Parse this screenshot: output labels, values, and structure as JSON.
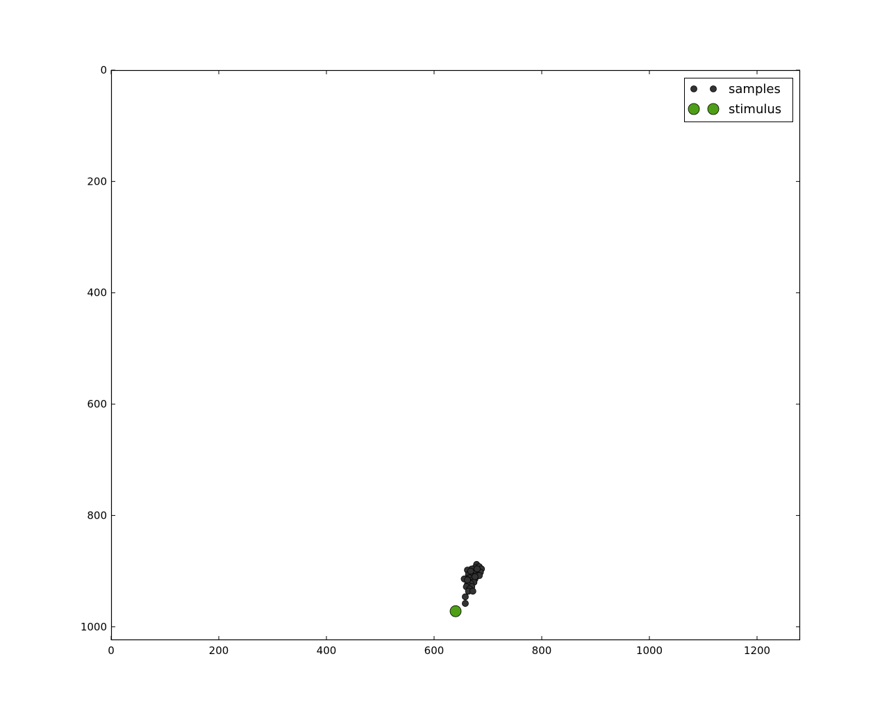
{
  "chart_data": {
    "type": "scatter",
    "title": "",
    "xlabel": "",
    "ylabel": "",
    "xlim": [
      0,
      1280
    ],
    "ylim": [
      1024,
      0
    ],
    "y_inverted": true,
    "grid": false,
    "legend_position": "top-right",
    "x_ticks": [
      0,
      200,
      400,
      600,
      800,
      1000,
      1200
    ],
    "y_ticks": [
      0,
      200,
      400,
      600,
      800,
      1000
    ],
    "series": [
      {
        "name": "samples",
        "color": "#333333",
        "marker": "small-circle",
        "points": [
          [
            679,
            888
          ],
          [
            684,
            892
          ],
          [
            688,
            896
          ],
          [
            676,
            894
          ],
          [
            670,
            896
          ],
          [
            662,
            898
          ],
          [
            682,
            900
          ],
          [
            686,
            902
          ],
          [
            678,
            904
          ],
          [
            674,
            902
          ],
          [
            668,
            904
          ],
          [
            664,
            906
          ],
          [
            680,
            908
          ],
          [
            684,
            908
          ],
          [
            672,
            910
          ],
          [
            666,
            912
          ],
          [
            660,
            914
          ],
          [
            656,
            914
          ],
          [
            676,
            914
          ],
          [
            670,
            916
          ],
          [
            664,
            918
          ],
          [
            674,
            920
          ],
          [
            668,
            922
          ],
          [
            662,
            924
          ],
          [
            660,
            928
          ],
          [
            670,
            928
          ],
          [
            666,
            932
          ],
          [
            664,
            936
          ],
          [
            672,
            936
          ],
          [
            658,
            946
          ],
          [
            658,
            958
          ],
          [
            680,
            896
          ],
          [
            668,
            900
          ],
          [
            676,
            910
          ],
          [
            662,
            916
          ]
        ]
      },
      {
        "name": "stimulus",
        "color": "#4f9f16",
        "marker": "large-circle",
        "points": [
          [
            640,
            972
          ]
        ]
      }
    ]
  }
}
